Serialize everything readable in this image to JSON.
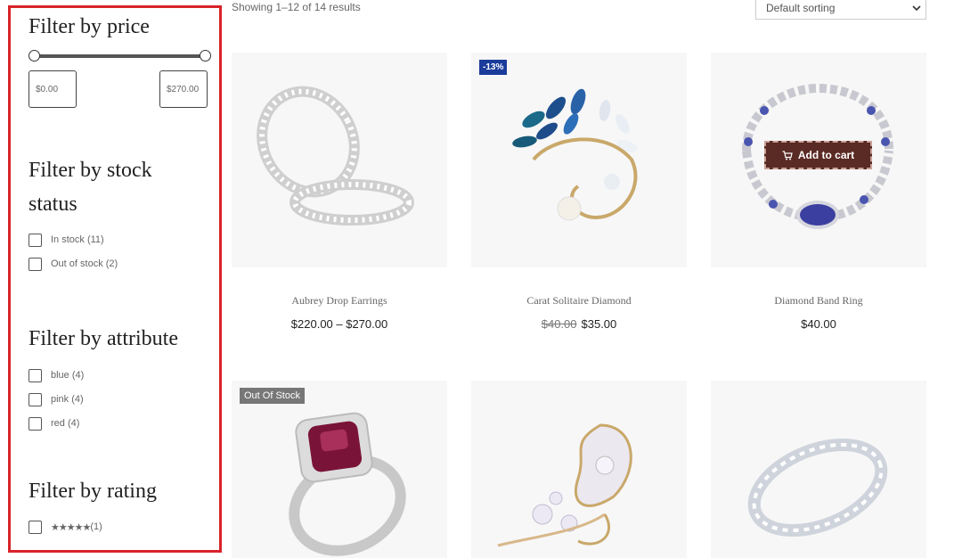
{
  "sidebar": {
    "price": {
      "title": "Filter by price",
      "min_value": "$0.00",
      "max_value": "$270.00"
    },
    "stock": {
      "title_line1": "Filter by stock",
      "title_line2": "status",
      "options": [
        {
          "label": "In stock",
          "count": "(11)"
        },
        {
          "label": "Out of stock",
          "count": "(2)"
        }
      ]
    },
    "attribute": {
      "title": "Filter by attribute",
      "options": [
        {
          "label": "blue",
          "count": "(4)"
        },
        {
          "label": "pink",
          "count": "(4)"
        },
        {
          "label": "red",
          "count": "(4)"
        }
      ]
    },
    "rating": {
      "title": "Filter by rating",
      "stars": "★★★★★",
      "count": "(1)",
      "rating_value": 5
    }
  },
  "toolbar": {
    "results_text": "Showing 1–12 of 14 results",
    "sort_value": "Default sorting"
  },
  "products": [
    {
      "name": "Aubrey Drop Earrings",
      "price": "$220.00 – $270.00"
    },
    {
      "name": "Carat Solitaire Diamond",
      "old_price": "$40.00",
      "price": "$35.00",
      "badge": "-13%"
    },
    {
      "name": "Diamond Band Ring",
      "price": "$40.00",
      "button": "Add to cart"
    },
    {
      "name": "",
      "badge": "Out Of Stock"
    },
    {
      "name": ""
    },
    {
      "name": ""
    }
  ],
  "colors": {
    "sidebar_border": "#d9232a",
    "sale_badge": "#1b3c9a",
    "cart_button": "#5a2a24",
    "stock_badge": "#777777"
  }
}
